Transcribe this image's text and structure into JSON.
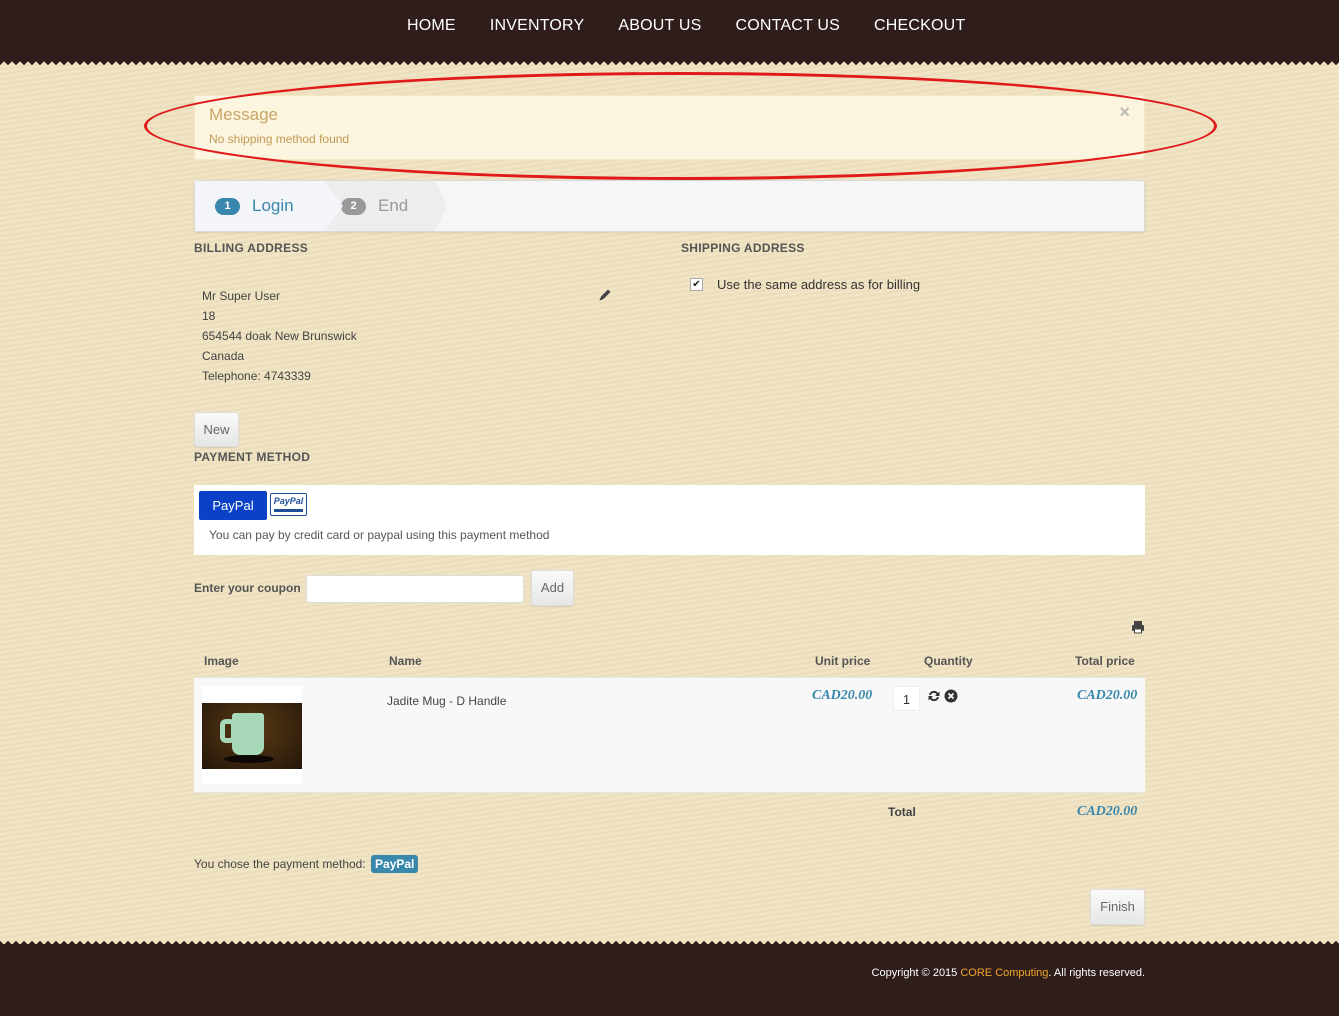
{
  "nav": {
    "items": [
      "HOME",
      "INVENTORY",
      "ABOUT US",
      "CONTACT US",
      "CHECKOUT"
    ]
  },
  "message": {
    "title": "Message",
    "text": "No shipping method found",
    "close": "×"
  },
  "steps": [
    {
      "number": "1",
      "label": "Login"
    },
    {
      "number": "2",
      "label": "End"
    }
  ],
  "billing": {
    "title": "BILLING ADDRESS",
    "lines": [
      "Mr Super User",
      "18",
      "654544 doak New Brunswick",
      "Canada",
      "Telephone: 4743339"
    ],
    "new_button": "New"
  },
  "shipping": {
    "title": "SHIPPING ADDRESS",
    "same_address_label": "Use the same address as for billing",
    "same_address_checked": true
  },
  "payment": {
    "title": "PAYMENT METHOD",
    "button_label": "PayPal",
    "logo_text": "PayPal",
    "description": "You can pay by credit card or paypal using this payment method"
  },
  "coupon": {
    "label": "Enter your coupon",
    "value": "",
    "add_button": "Add"
  },
  "cart": {
    "headers": {
      "image": "Image",
      "name": "Name",
      "unit_price": "Unit price",
      "quantity": "Quantity",
      "total_price": "Total price"
    },
    "items": [
      {
        "name": "Jadite Mug - D Handle",
        "unit_price": "CAD20.00",
        "quantity": "1",
        "total_price": "CAD20.00"
      }
    ],
    "total_label": "Total",
    "total_value": "CAD20.00"
  },
  "summary": {
    "chose_text": "You chose the payment method:",
    "method": "PayPal"
  },
  "finish_button": "Finish",
  "footer": {
    "prefix": "Copyright © 2015 ",
    "brand": "CORE Computing",
    "suffix": ". All rights reserved."
  }
}
